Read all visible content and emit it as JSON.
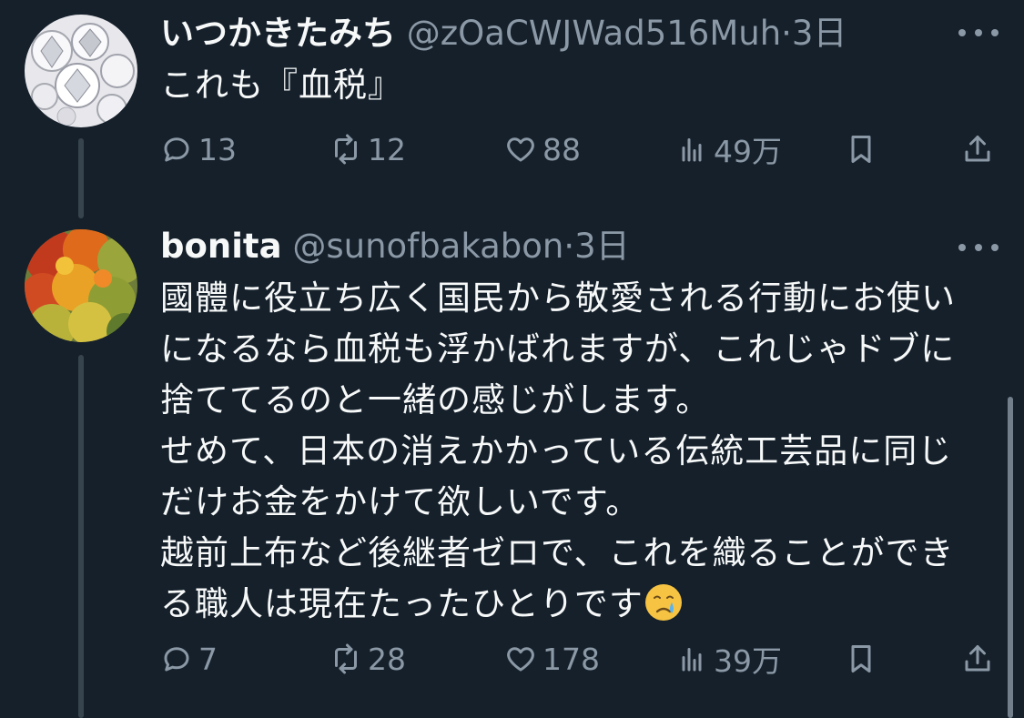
{
  "tweets": [
    {
      "display_name": "いつかきたみち",
      "handle": "@zOaCWJWad516Muh",
      "separator": "·",
      "time": "3日",
      "text": "これも『血税』",
      "replies": "13",
      "retweets": "12",
      "likes": "88",
      "views": "49万",
      "avatar_icon": "diamonds-avatar"
    },
    {
      "display_name": "bonita",
      "handle": "@sunofbakabon",
      "separator": "·",
      "time": "3日",
      "text": "國體に役立ち広く国民から敬愛される行動にお使いになるなら血税も浮かばれますが、これじゃドブに捨ててるのと一緒の感じがします。\nせめて、日本の消えかかっている伝統工芸品に同じだけお金をかけて欲しいです。\n越前上布など後継者ゼロで、これを織ることができる職人は現在たったひとりです",
      "emoji": "crying-face-emoji",
      "replies": "7",
      "retweets": "28",
      "likes": "178",
      "views": "39万",
      "avatar_icon": "autumn-leaves-avatar"
    }
  ],
  "colors": {
    "background": "#15202b",
    "primary_text": "#f7f9f9",
    "secondary_text": "#8b98a5",
    "thread_line": "#38444d"
  }
}
